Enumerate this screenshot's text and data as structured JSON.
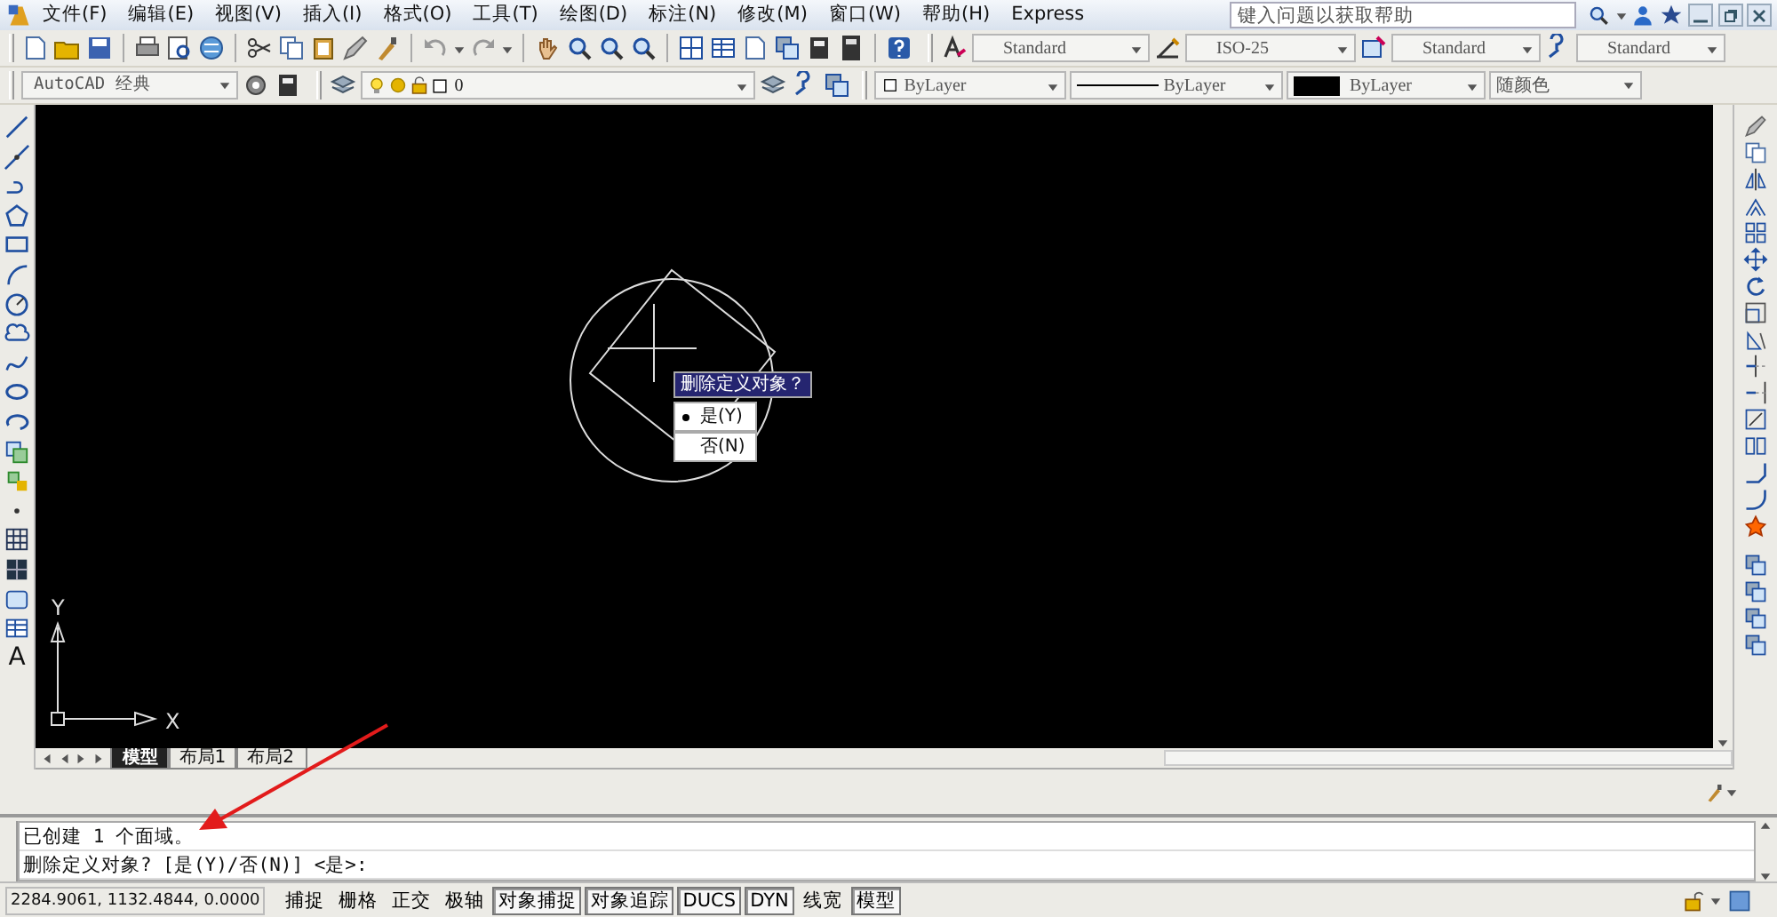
{
  "menu": [
    {
      "label": "文件(F)"
    },
    {
      "label": "编辑(E)"
    },
    {
      "label": "视图(V)"
    },
    {
      "label": "插入(I)"
    },
    {
      "label": "格式(O)"
    },
    {
      "label": "工具(T)"
    },
    {
      "label": "绘图(D)"
    },
    {
      "label": "标注(N)"
    },
    {
      "label": "修改(M)"
    },
    {
      "label": "窗口(W)"
    },
    {
      "label": "帮助(H)"
    },
    {
      "label": "Express"
    }
  ],
  "help_search": {
    "placeholder": "键入问题以获取帮助"
  },
  "style_dropdowns": [
    {
      "value": "Standard"
    },
    {
      "value": "ISO-25"
    },
    {
      "value": "Standard"
    },
    {
      "value": "Standard"
    }
  ],
  "workspace": {
    "value": "AutoCAD 经典"
  },
  "layer": {
    "value": "0"
  },
  "properties": [
    {
      "kind": "color",
      "value": "ByLayer"
    },
    {
      "kind": "linetype",
      "value": "ByLayer"
    },
    {
      "kind": "lineweight",
      "value": "ByLayer"
    },
    {
      "kind": "plotstyle",
      "value": "随颜色"
    }
  ],
  "draw_toolbar": {
    "text_tool": "A"
  },
  "canvas": {
    "ucs_y": "Y",
    "ucs_x": "X",
    "prompt": {
      "title": "删除定义对象？",
      "options": [
        {
          "label": "是(Y)",
          "selected": true
        },
        {
          "label": "否(N)",
          "selected": false
        }
      ]
    }
  },
  "layout_tabs": [
    {
      "label": "模型",
      "selected": true
    },
    {
      "label": "布局1",
      "selected": false
    },
    {
      "label": "布局2",
      "selected": false
    }
  ],
  "command_lines": [
    "已创建 1 个面域。",
    "删除定义对象? [是(Y)/否(N)] <是>:"
  ],
  "status_bar": {
    "coordinates": "2284.9061, 1132.4844, 0.0000",
    "toggles": [
      {
        "label": "捕捉",
        "on": false
      },
      {
        "label": "栅格",
        "on": false
      },
      {
        "label": "正交",
        "on": false
      },
      {
        "label": "极轴",
        "on": false
      },
      {
        "label": "对象捕捉",
        "on": true
      },
      {
        "label": "对象追踪",
        "on": true
      },
      {
        "label": "DUCS",
        "on": true
      },
      {
        "label": "DYN",
        "on": true
      },
      {
        "label": "线宽",
        "on": false
      },
      {
        "label": "模型",
        "on": true
      }
    ]
  }
}
